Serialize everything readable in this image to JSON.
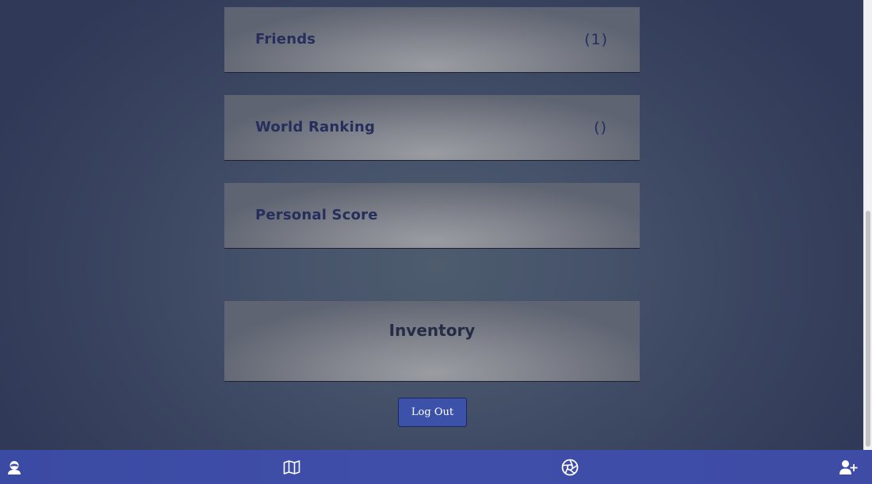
{
  "cards": {
    "friends": {
      "title": "Friends",
      "count": "(1)"
    },
    "world_ranking": {
      "title": "World Ranking",
      "count": "()"
    },
    "personal_score": {
      "title": "Personal Score"
    }
  },
  "inventory": {
    "title": "Inventory"
  },
  "logout": {
    "label": "Log Out"
  },
  "navbar": {
    "items": [
      {
        "icon": "profile-icon"
      },
      {
        "icon": "map-icon"
      },
      {
        "icon": "aperture-icon"
      },
      {
        "icon": "add-user-icon"
      }
    ]
  },
  "colors": {
    "card_text": "#262f5c",
    "button_bg": "#3b52a8",
    "navbar_bg": "#3f4ea8"
  }
}
